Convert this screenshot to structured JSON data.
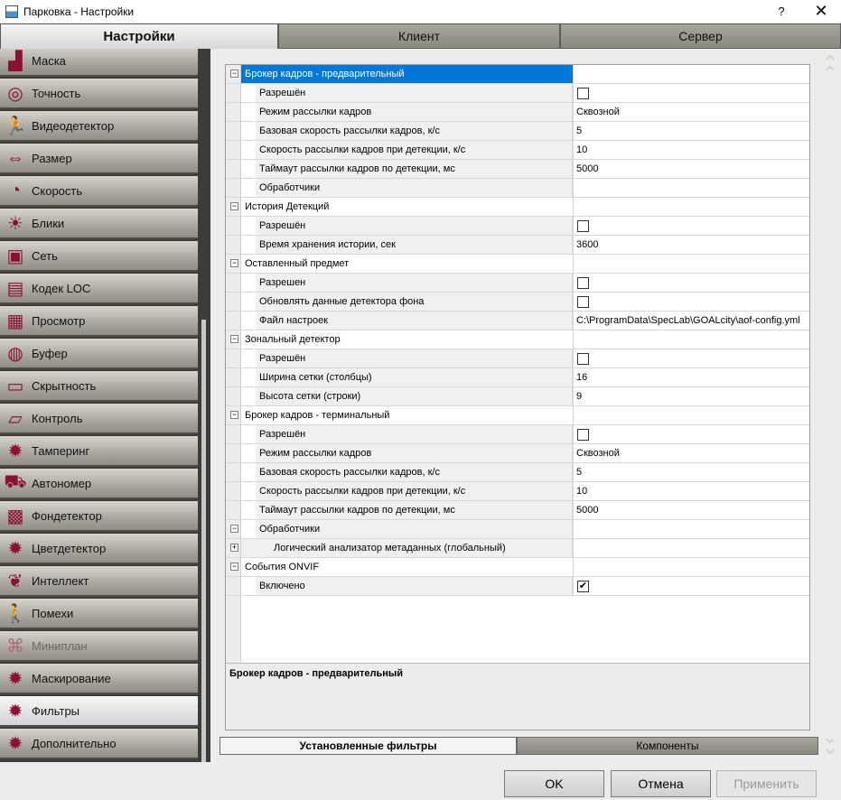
{
  "window": {
    "title": "Парковка - Настройки",
    "help": "?",
    "close": "✕"
  },
  "top_tabs": [
    {
      "label": "Настройки",
      "active": true
    },
    {
      "label": "Клиент",
      "active": false
    },
    {
      "label": "Сервер",
      "active": false
    }
  ],
  "sidebar": {
    "items": [
      {
        "label": "Маска",
        "icon": "mask-icon",
        "glyph": "▟"
      },
      {
        "label": "Точность",
        "icon": "target-icon",
        "glyph": "◎"
      },
      {
        "label": "Видеодетектор",
        "icon": "running-person-icon",
        "glyph": "🏃"
      },
      {
        "label": "Размер",
        "icon": "size-icon",
        "glyph": "⇔"
      },
      {
        "label": "Скорость",
        "icon": "speedometer-icon",
        "glyph": "◔"
      },
      {
        "label": "Блики",
        "icon": "sun-glare-icon",
        "glyph": "☀"
      },
      {
        "label": "Сеть",
        "icon": "network-icon",
        "glyph": "▣"
      },
      {
        "label": "Кодек LOC",
        "icon": "codec-icon",
        "glyph": "▤"
      },
      {
        "label": "Просмотр",
        "icon": "preview-icon",
        "glyph": "▦"
      },
      {
        "label": "Буфер",
        "icon": "buffer-icon",
        "glyph": "◍"
      },
      {
        "label": "Скрытность",
        "icon": "monitor-icon",
        "glyph": "▭"
      },
      {
        "label": "Контроль",
        "icon": "control-icon",
        "glyph": "▱"
      },
      {
        "label": "Тамперинг",
        "icon": "gear-icon",
        "glyph": "✹"
      },
      {
        "label": "Автономер",
        "icon": "car-icon",
        "glyph": "⛟"
      },
      {
        "label": "Фондетектор",
        "icon": "background-detector-icon",
        "glyph": "▩"
      },
      {
        "label": "Цветдетектор",
        "icon": "gear-icon",
        "glyph": "✹"
      },
      {
        "label": "Интеллект",
        "icon": "brain-icon",
        "glyph": "❦"
      },
      {
        "label": "Помехи",
        "icon": "walking-person-icon",
        "glyph": "🚶"
      },
      {
        "label": "Миниплан",
        "icon": "miniplan-icon",
        "glyph": "⌘",
        "disabled": true
      },
      {
        "label": "Маскирование",
        "icon": "gear-icon",
        "glyph": "✹"
      },
      {
        "label": "Фильтры",
        "icon": "gear-icon",
        "glyph": "✹",
        "selected": true
      },
      {
        "label": "Дополнительно",
        "icon": "gear-icon",
        "glyph": "✹"
      }
    ]
  },
  "grid": {
    "rows": [
      {
        "type": "cat",
        "name": "Брокер кадров - предварительный",
        "expander": "−",
        "selected": true
      },
      {
        "type": "child",
        "name": "Разрешён",
        "checkbox": ""
      },
      {
        "type": "child",
        "name": "Режим рассылки кадров",
        "value": "Сквозной"
      },
      {
        "type": "child",
        "name": "Базовая скорость рассылки кадров, к/с",
        "value": "5"
      },
      {
        "type": "child",
        "name": "Скорость рассылки кадров при детекции, к/с",
        "value": "10"
      },
      {
        "type": "child",
        "name": "Таймаут рассылки кадров по детекции, мс",
        "value": "5000"
      },
      {
        "type": "child",
        "name": "Обработчики",
        "value": ""
      },
      {
        "type": "cat",
        "name": "История Детекций",
        "expander": "−"
      },
      {
        "type": "child",
        "name": "Разрешён",
        "checkbox": ""
      },
      {
        "type": "child",
        "name": "Время хранения истории, сек",
        "value": "3600"
      },
      {
        "type": "cat",
        "name": "Оставленный предмет",
        "expander": "−"
      },
      {
        "type": "child",
        "name": "Разрешен",
        "checkbox": ""
      },
      {
        "type": "child",
        "name": "Обновлять данные детектора фона",
        "checkbox": ""
      },
      {
        "type": "child",
        "name": "Файл настроек",
        "value": "C:\\ProgramData\\SpecLab\\GOALcity\\aof-config.yml"
      },
      {
        "type": "cat",
        "name": "Зональный детектор",
        "expander": "−"
      },
      {
        "type": "child",
        "name": "Разрешён",
        "checkbox": ""
      },
      {
        "type": "child",
        "name": "Ширина сетки (столбцы)",
        "value": "16"
      },
      {
        "type": "child",
        "name": "Высота сетки (строки)",
        "value": "9"
      },
      {
        "type": "cat",
        "name": "Брокер кадров - терминальный",
        "expander": "−"
      },
      {
        "type": "child",
        "name": "Разрешён",
        "checkbox": ""
      },
      {
        "type": "child",
        "name": "Режим рассылки кадров",
        "value": "Сквозной"
      },
      {
        "type": "child",
        "name": "Базовая скорость рассылки кадров, к/с",
        "value": "5"
      },
      {
        "type": "child",
        "name": "Скорость рассылки кадров при детекции, к/с",
        "value": "10"
      },
      {
        "type": "child",
        "name": "Таймаут рассылки кадров по детекции, мс",
        "value": "5000"
      },
      {
        "type": "child",
        "name": "Обработчики",
        "value": "",
        "expander": "−"
      },
      {
        "type": "subchild",
        "name": "Логический анализатор метаданных (глобальный)",
        "value": "",
        "expander": "+"
      },
      {
        "type": "cat",
        "name": "События ONVIF",
        "expander": "−"
      },
      {
        "type": "child",
        "name": "Включено",
        "checkbox": "✔"
      }
    ]
  },
  "description": {
    "title": "Брокер кадров - предварительный"
  },
  "sub_tabs": {
    "installed": "Установленные фильтры",
    "components": "Компоненты"
  },
  "buttons": {
    "ok": "OK",
    "cancel": "Отмена",
    "apply": "Применить"
  },
  "scroll": {
    "up": "⌃",
    "down": "⌄"
  }
}
